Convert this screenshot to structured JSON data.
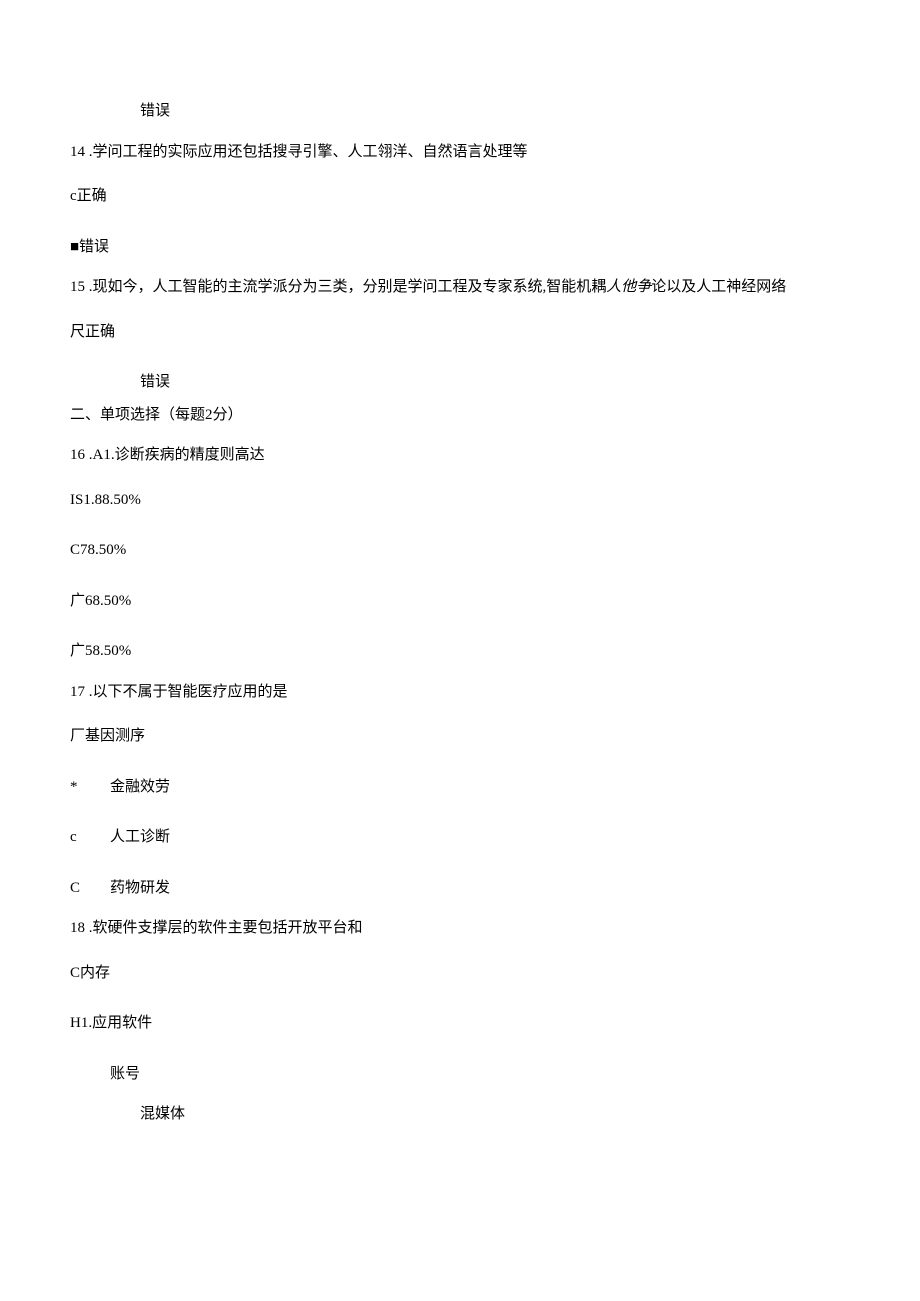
{
  "lines": {
    "l1": "错误",
    "l2a": "14",
    "l2b": " .学问工程的实际应用还包括搜寻引擎、人工翎洋、自然语言处理等",
    "l3": "c正确",
    "l4": "■错误",
    "l5a": "15",
    "l5b": " .现如今，人工智能的主流学派分为三类，分别是学问工程及专家系统,智能机耦",
    "l5c": "人他争",
    "l5d": "论以及人工神经网络",
    "l6": "尺正确",
    "l7": "错误",
    "l8": "二、单项选择（每题2分）",
    "l9a": "16",
    "l9b": " .A1.诊断疾病的精度则高达",
    "l10": "IS1.88.50%",
    "l11": "C78.50%",
    "l12": "广68.50%",
    "l13": "广58.50%",
    "l14a": "17",
    "l14b": " .以下不属于智能医疗应用的是",
    "l15": "厂基因测序",
    "l16a": "*",
    "l16b": "金融效劳",
    "l17a": "c",
    "l17b": "人工诊断",
    "l18a": "C",
    "l18b": "药物研发",
    "l19a": "18",
    "l19b": " .软硬件支撑层的软件主要包括开放平台和",
    "l20": "C内存",
    "l21": "H1.应用软件",
    "l22": "账号",
    "l23": "混媒体"
  }
}
